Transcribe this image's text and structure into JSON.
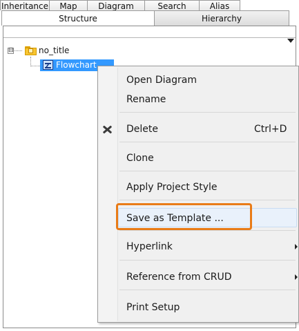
{
  "tabs_top": [
    {
      "label": "Inheritance"
    },
    {
      "label": "Map"
    },
    {
      "label": "Diagram"
    },
    {
      "label": "Search"
    },
    {
      "label": "Alias"
    }
  ],
  "tabs_bottom": [
    {
      "label": "Structure",
      "active": true
    },
    {
      "label": "Hierarchy",
      "active": false
    }
  ],
  "tree": {
    "root": {
      "label": "no_title",
      "icon": "folder-icon",
      "expander": "⊟"
    },
    "child": {
      "label": "Flowchart",
      "icon": "flowchart-diagram-icon",
      "selected": true
    }
  },
  "context_menu": {
    "items": [
      {
        "label": "Open Diagram"
      },
      {
        "label": "Rename"
      },
      {
        "label": "Delete",
        "shortcut": "Ctrl+D",
        "icon": "delete-icon"
      },
      {
        "label": "Clone"
      },
      {
        "label": "Apply Project Style"
      },
      {
        "label": "Save as Template ...",
        "highlighted": true
      },
      {
        "label": "Hyperlink",
        "submenu": true
      },
      {
        "label": "Reference from CRUD",
        "submenu": true
      },
      {
        "label": "Print Setup"
      }
    ]
  },
  "colors": {
    "selection": "#3399ff",
    "callout": "#e97b17",
    "menu_background": "#f0f0f0"
  }
}
